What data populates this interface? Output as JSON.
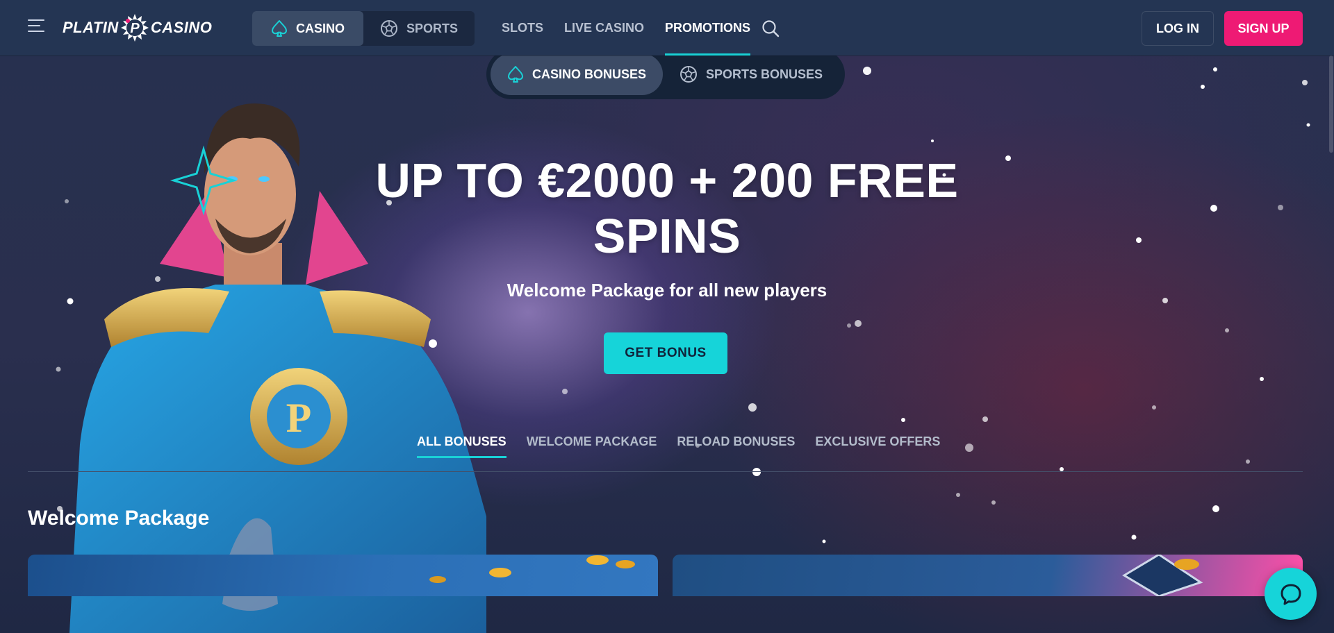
{
  "header": {
    "logo": {
      "text_left": "PLATIN",
      "text_right": "CASINO",
      "mark_letter": "P"
    },
    "mode_switch": [
      {
        "label": "CASINO",
        "icon": "spade-icon",
        "active": true
      },
      {
        "label": "SPORTS",
        "icon": "soccer-ball-icon",
        "active": false
      }
    ],
    "nav": [
      {
        "label": "SLOTS",
        "active": false
      },
      {
        "label": "LIVE CASINO",
        "active": false
      },
      {
        "label": "PROMOTIONS",
        "active": true
      }
    ],
    "login_label": "LOG IN",
    "signup_label": "SIGN UP"
  },
  "hero": {
    "bonus_switch": [
      {
        "label": "CASINO BONUSES",
        "icon": "spade-icon",
        "active": true
      },
      {
        "label": "SPORTS BONUSES",
        "icon": "soccer-ball-icon",
        "active": false
      }
    ],
    "title_line1": "UP TO €2000 + 200 FREE",
    "title_line2": "SPINS",
    "subtitle": "Welcome Package for all new players",
    "cta_label": "GET BONUS"
  },
  "tabs": [
    {
      "label": "ALL BONUSES",
      "active": true
    },
    {
      "label": "WELCOME PACKAGE",
      "active": false
    },
    {
      "label": "RELOAD BONUSES",
      "active": false
    },
    {
      "label": "EXCLUSIVE OFFERS",
      "active": false
    }
  ],
  "section": {
    "title": "Welcome Package"
  },
  "colors": {
    "accent": "#16d4d9",
    "signup": "#ee1a74",
    "header_bg": "#243553"
  },
  "chat": {
    "icon": "chat-bubble-icon"
  }
}
